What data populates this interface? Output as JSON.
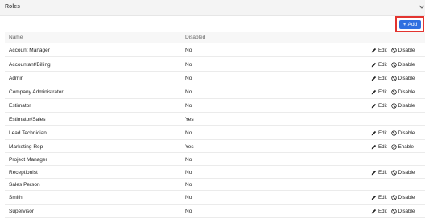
{
  "panel": {
    "title": "Roles"
  },
  "toolbar": {
    "add_label": "Add"
  },
  "table": {
    "columns": [
      "Name",
      "Disabled"
    ],
    "rows": [
      {
        "name": "Account Manager",
        "disabled": "No",
        "actions": [
          "Edit",
          "Disable"
        ]
      },
      {
        "name": "Accountant/Billing",
        "disabled": "No",
        "actions": [
          "Edit",
          "Disable"
        ]
      },
      {
        "name": "Admin",
        "disabled": "No",
        "actions": [
          "Edit",
          "Disable"
        ]
      },
      {
        "name": "Company Administrator",
        "disabled": "No",
        "actions": [
          "Edit",
          "Disable"
        ]
      },
      {
        "name": "Estimator",
        "disabled": "No",
        "actions": [
          "Edit",
          "Disable"
        ]
      },
      {
        "name": "Estimator/Sales",
        "disabled": "Yes",
        "actions": []
      },
      {
        "name": "Lead Technician",
        "disabled": "No",
        "actions": [
          "Edit",
          "Disable"
        ]
      },
      {
        "name": "Marketing Rep",
        "disabled": "Yes",
        "actions": [
          "Edit",
          "Enable"
        ]
      },
      {
        "name": "Project Manager",
        "disabled": "No",
        "actions": []
      },
      {
        "name": "Receptionist",
        "disabled": "No",
        "actions": [
          "Edit",
          "Disable"
        ]
      },
      {
        "name": "Sales Person",
        "disabled": "No",
        "actions": []
      },
      {
        "name": "Smith",
        "disabled": "No",
        "actions": [
          "Edit",
          "Disable"
        ]
      },
      {
        "name": "Supervisor",
        "disabled": "No",
        "actions": [
          "Edit",
          "Disable"
        ]
      }
    ]
  },
  "colors": {
    "primary": "#2f6fe0",
    "highlight": "#e3342f"
  },
  "icons": {
    "collapse": "chevron-down-icon",
    "add": "plus-icon",
    "edit": "pencil-icon",
    "disable": "ban-icon",
    "enable": "check-circle-icon"
  }
}
